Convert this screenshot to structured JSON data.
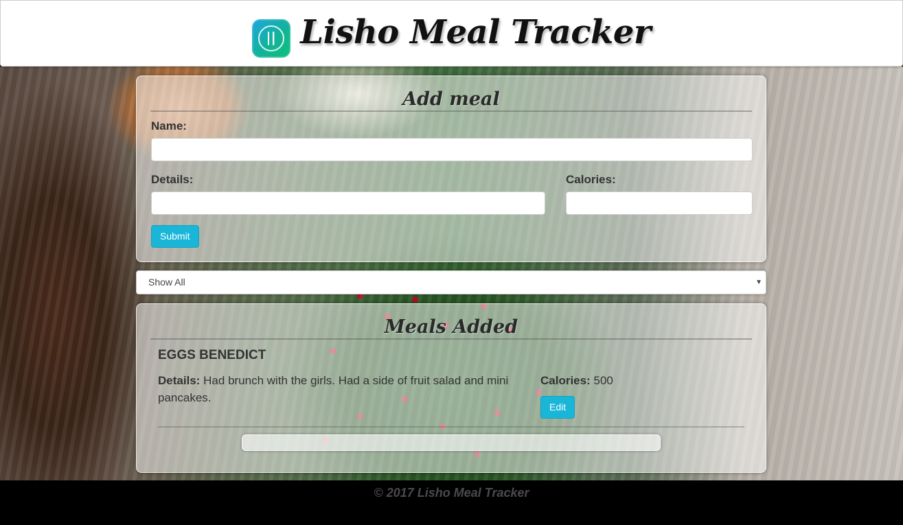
{
  "header": {
    "title": "Lisho Meal Tracker",
    "logo_icon": "fork-knife-icon"
  },
  "add_meal": {
    "title": "Add meal",
    "name_label": "Name:",
    "name_value": "",
    "details_label": "Details:",
    "details_value": "",
    "calories_label": "Calories:",
    "calories_value": "",
    "submit_label": "Submit"
  },
  "filter": {
    "selected": "Show All"
  },
  "meals": {
    "title": "Meals Added",
    "items": [
      {
        "name": "EGGS BENEDICT",
        "details_label": "Details:",
        "details": "Had brunch with the girls. Had a side of fruit salad and mini pancakes.",
        "calories_label": "Calories:",
        "calories": "500",
        "edit_label": "Edit"
      }
    ]
  },
  "footer": {
    "text": "© 2017 Lisho Meal Tracker"
  },
  "colors": {
    "accent": "#1ab6d8",
    "logo_gradient_start": "#1ea7e0",
    "logo_gradient_end": "#0fbf7a"
  }
}
